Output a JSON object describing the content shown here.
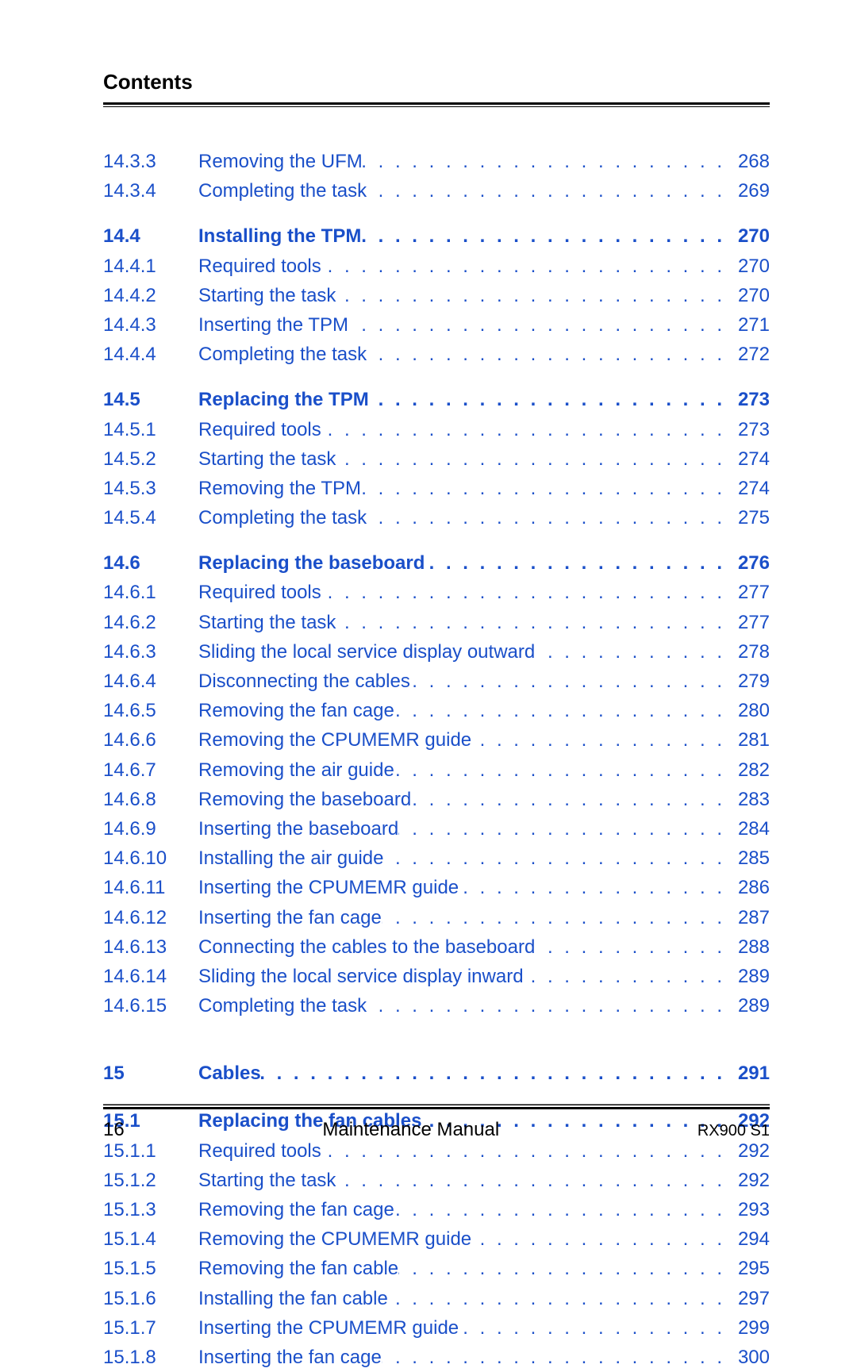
{
  "header": {
    "title": "Contents"
  },
  "footer": {
    "page": "16",
    "mid": "Maintenance Manual",
    "right": "RX900 S1"
  },
  "dots": ". . . . . . . . . . . . . . . . . . . . . . . . . . . . . . . . . . . . . . . . . . . . .",
  "groups": [
    {
      "rows": [
        {
          "num": "14.3.3",
          "text": "Removing the UFM",
          "page": "268",
          "bold": false
        },
        {
          "num": "14.3.4",
          "text": "Completing the task",
          "page": "269",
          "bold": false
        }
      ]
    },
    {
      "rows": [
        {
          "num": "14.4",
          "text": "Installing the TPM",
          "page": "270",
          "bold": true
        },
        {
          "num": "14.4.1",
          "text": "Required tools",
          "page": "270",
          "bold": false
        },
        {
          "num": "14.4.2",
          "text": "Starting the task",
          "page": "270",
          "bold": false
        },
        {
          "num": "14.4.3",
          "text": "Inserting the TPM",
          "page": "271",
          "bold": false
        },
        {
          "num": "14.4.4",
          "text": "Completing the task",
          "page": "272",
          "bold": false
        }
      ]
    },
    {
      "rows": [
        {
          "num": "14.5",
          "text": "Replacing the TPM",
          "page": "273",
          "bold": true
        },
        {
          "num": "14.5.1",
          "text": "Required tools",
          "page": "273",
          "bold": false
        },
        {
          "num": "14.5.2",
          "text": "Starting the task",
          "page": "274",
          "bold": false
        },
        {
          "num": "14.5.3",
          "text": "Removing the TPM",
          "page": "274",
          "bold": false
        },
        {
          "num": "14.5.4",
          "text": "Completing the task",
          "page": "275",
          "bold": false
        }
      ]
    },
    {
      "rows": [
        {
          "num": "14.6",
          "text": "Replacing the baseboard",
          "page": "276",
          "bold": true
        },
        {
          "num": "14.6.1",
          "text": "Required tools",
          "page": "277",
          "bold": false
        },
        {
          "num": "14.6.2",
          "text": "Starting the task",
          "page": "277",
          "bold": false
        },
        {
          "num": "14.6.3",
          "text": "Sliding the local service display outward",
          "page": "278",
          "bold": false
        },
        {
          "num": "14.6.4",
          "text": "Disconnecting the cables",
          "page": "279",
          "bold": false
        },
        {
          "num": "14.6.5",
          "text": "Removing the fan cage",
          "page": "280",
          "bold": false
        },
        {
          "num": "14.6.6",
          "text": "Removing the CPUMEMR guide",
          "page": "281",
          "bold": false
        },
        {
          "num": "14.6.7",
          "text": "Removing the air guide",
          "page": "282",
          "bold": false
        },
        {
          "num": "14.6.8",
          "text": "Removing the baseboard",
          "page": "283",
          "bold": false
        },
        {
          "num": "14.6.9",
          "text": "Inserting the baseboard",
          "page": "284",
          "bold": false
        },
        {
          "num": "14.6.10",
          "text": "Installing the air guide",
          "page": "285",
          "bold": false
        },
        {
          "num": "14.6.11",
          "text": "Inserting the CPUMEMR guide",
          "page": "286",
          "bold": false
        },
        {
          "num": "14.6.12",
          "text": "Inserting the fan cage",
          "page": "287",
          "bold": false
        },
        {
          "num": "14.6.13",
          "text": "Connecting the cables to the baseboard",
          "page": "288",
          "bold": false
        },
        {
          "num": "14.6.14",
          "text": "Sliding the local service display inward",
          "page": "289",
          "bold": false
        },
        {
          "num": "14.6.15",
          "text": "Completing the task",
          "page": "289",
          "bold": false
        }
      ]
    },
    {
      "spacerBefore": true,
      "ruleAfter": true,
      "rows": [
        {
          "num": "15",
          "text": "Cables",
          "page": "291",
          "bold": true
        }
      ]
    },
    {
      "rows": [
        {
          "num": "15.1",
          "text": "Replacing the fan cables",
          "page": "292",
          "bold": true
        },
        {
          "num": "15.1.1",
          "text": "Required tools",
          "page": "292",
          "bold": false
        },
        {
          "num": "15.1.2",
          "text": "Starting the task",
          "page": "292",
          "bold": false
        },
        {
          "num": "15.1.3",
          "text": "Removing the fan cage",
          "page": "293",
          "bold": false
        },
        {
          "num": "15.1.4",
          "text": "Removing the CPUMEMR guide",
          "page": "294",
          "bold": false
        },
        {
          "num": "15.1.5",
          "text": "Removing the fan cable",
          "page": "295",
          "bold": false
        },
        {
          "num": "15.1.6",
          "text": "Installing the fan cable",
          "page": "297",
          "bold": false
        },
        {
          "num": "15.1.7",
          "text": "Inserting the CPUMEMR guide",
          "page": "299",
          "bold": false
        },
        {
          "num": "15.1.8",
          "text": "Inserting the fan cage",
          "page": "300",
          "bold": false
        }
      ]
    }
  ]
}
